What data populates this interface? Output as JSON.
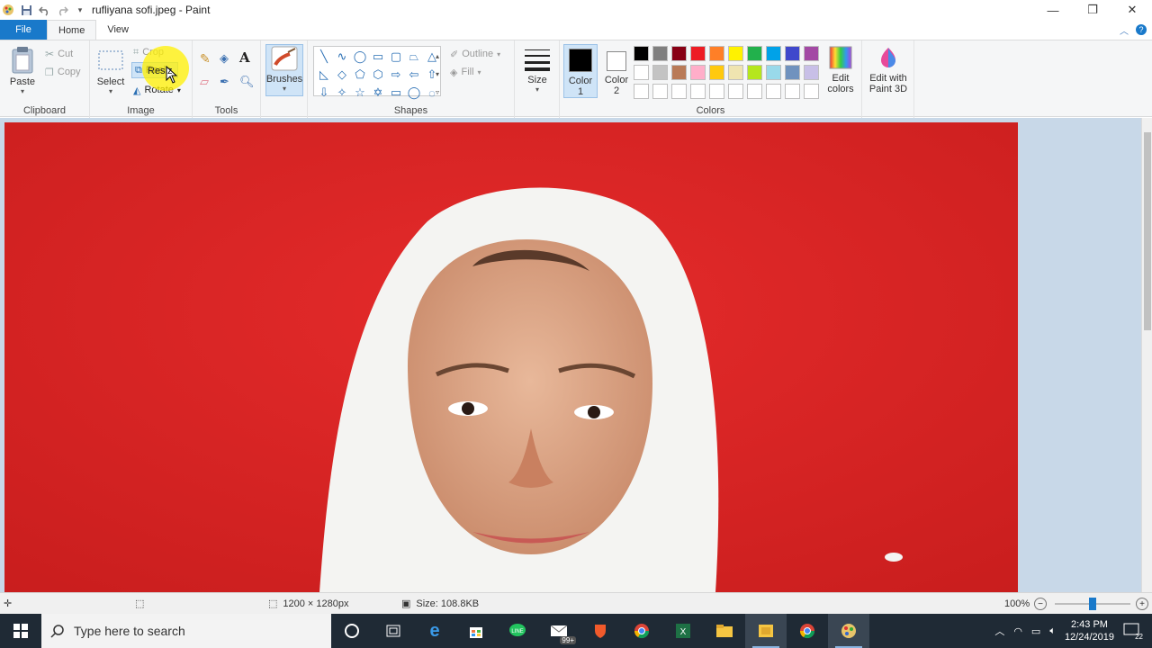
{
  "window": {
    "title": "rufliyana sofi.jpeg - Paint",
    "controls": {
      "minimize": "—",
      "maximize": "❐",
      "close": "✕"
    }
  },
  "tabs": {
    "file": "File",
    "home": "Home",
    "view": "View"
  },
  "ribbon": {
    "clipboard": {
      "label": "Clipboard",
      "paste": "Paste",
      "cut": "Cut",
      "copy": "Copy"
    },
    "image": {
      "label": "Image",
      "select": "Select",
      "crop": "Crop",
      "resize": "Resiz",
      "rotate": "Rotate"
    },
    "tools": {
      "label": "Tools"
    },
    "brushes": {
      "label": "Brushes"
    },
    "shapes": {
      "label": "Shapes",
      "outline": "Outline",
      "fill": "Fill"
    },
    "size": {
      "label": "Size"
    },
    "colors": {
      "label": "Colors",
      "color1": "Color\n1",
      "color1_a": "Color",
      "color1_b": "1",
      "color2_a": "Color",
      "color2_b": "2",
      "edit_colors_a": "Edit",
      "edit_colors_b": "colors",
      "paint3d_a": "Edit with",
      "paint3d_b": "Paint 3D",
      "color1_value": "#000000",
      "color2_value": "#ffffff",
      "palette_row1": [
        "#000000",
        "#7f7f7f",
        "#880015",
        "#ed1c24",
        "#ff7f27",
        "#fff200",
        "#22b14c",
        "#00a2e8",
        "#3f48cc",
        "#a349a4"
      ],
      "palette_row2": [
        "#ffffff",
        "#c3c3c3",
        "#b97a57",
        "#ffaec9",
        "#ffc90e",
        "#efe4b0",
        "#b5e61d",
        "#99d9ea",
        "#7092be",
        "#c8bfe7"
      ],
      "palette_row3": [
        "#ffffff",
        "#ffffff",
        "#ffffff",
        "#ffffff",
        "#ffffff",
        "#ffffff",
        "#ffffff",
        "#ffffff",
        "#ffffff",
        "#ffffff"
      ]
    }
  },
  "status": {
    "dimensions": "1200 × 1280px",
    "size": "Size: 108.8KB",
    "zoom": "100%",
    "zoom_level": 0.5
  },
  "taskbar": {
    "search_placeholder": "Type here to search",
    "time": "2:43 PM",
    "date": "12/24/2019",
    "notification_count": "22",
    "mail_badge": "99+"
  }
}
